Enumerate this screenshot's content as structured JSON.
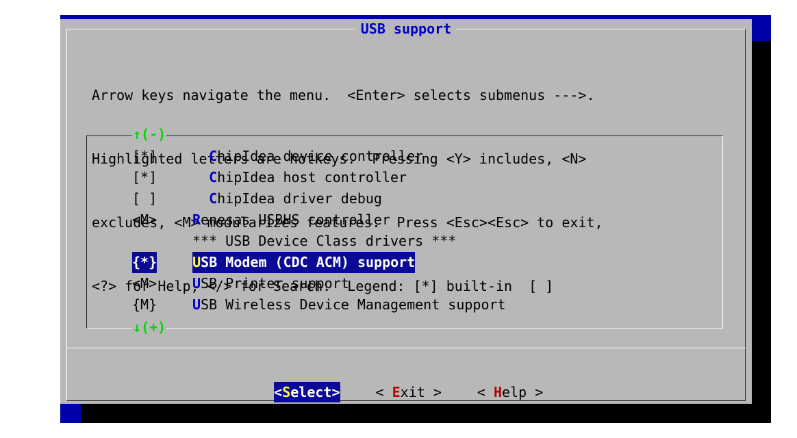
{
  "dialog": {
    "title": "USB support",
    "help_lines": [
      "Arrow keys navigate the menu.  <Enter> selects submenus --->.",
      "Highlighted letters are hotkeys.  Pressing <Y> includes, <N>",
      "excludes, <M> modularizes features.  Press <Esc><Esc> to exit,",
      "<?> for Help, </> for Search.  Legend: [*] built-in  [ ]"
    ],
    "scroll_up": "↑(-)",
    "scroll_down": "↓(+)"
  },
  "menu": {
    "items": [
      {
        "state": "[*]",
        "indent": "  ",
        "hotkey": "C",
        "rest": "hipIdea device controller"
      },
      {
        "state": "[*]",
        "indent": "  ",
        "hotkey": "C",
        "rest": "hipIdea host controller"
      },
      {
        "state": "[ ]",
        "indent": "  ",
        "hotkey": "C",
        "rest": "hipIdea driver debug"
      },
      {
        "state": "<M>",
        "indent": "",
        "hotkey": "R",
        "rest": "enesas USBHS controller"
      },
      {
        "state": "",
        "indent": "",
        "hotkey": "",
        "rest": "*** USB Device Class drivers ***"
      },
      {
        "state": "{*}",
        "indent": "",
        "hotkey": "U",
        "rest": "SB Modem (CDC ACM) support"
      },
      {
        "state": "<M>",
        "indent": "",
        "hotkey": "U",
        "rest": "SB Printer support"
      },
      {
        "state": "{M}",
        "indent": "",
        "hotkey": "U",
        "rest": "SB Wireless Device Management support"
      }
    ],
    "selected_index": 5
  },
  "buttons": {
    "select": {
      "open": "<",
      "hotkey": "S",
      "rest": "elect",
      "close": ">"
    },
    "exit": {
      "open": "< ",
      "hotkey": "E",
      "rest": "xit",
      "close": " >"
    },
    "help": {
      "open": "< ",
      "hotkey": "H",
      "rest": "elp",
      "close": " >"
    }
  },
  "colors": {
    "dialog_bg": "#b8b8b8",
    "title": "#0000c8",
    "highlight_bg": "#0a0a96",
    "hotkey_selected": "#ffff40",
    "scroll_indicator": "#00d800",
    "button_hotkey": "#b80000",
    "terminal_bg": "#0000a8"
  }
}
